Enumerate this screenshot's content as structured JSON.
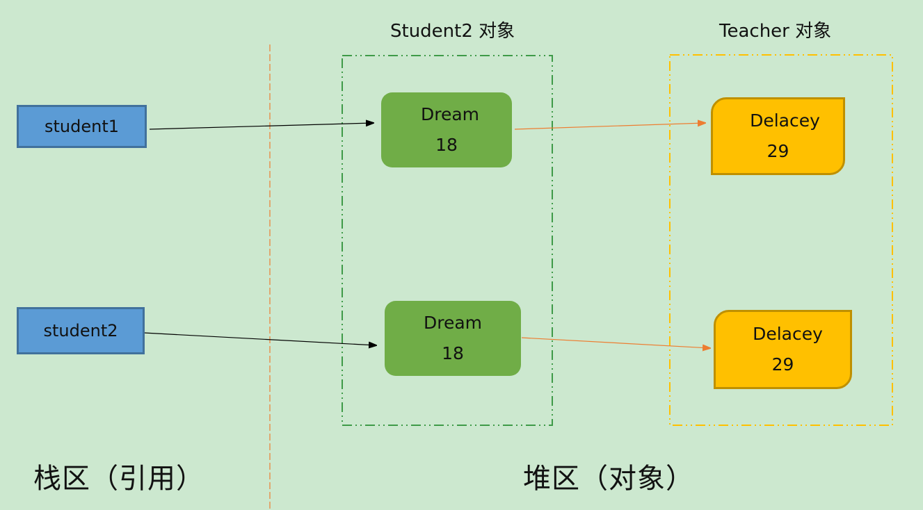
{
  "regions": {
    "stack_label": "栈区（引用）",
    "heap_label": "堆区（对象）"
  },
  "groups": {
    "student_group_title": "Student2 对象",
    "teacher_group_title": "Teacher 对象"
  },
  "references": [
    {
      "label": "student1"
    },
    {
      "label": "student2"
    }
  ],
  "student_objects": [
    {
      "name": "Dream",
      "age": "18"
    },
    {
      "name": "Dream",
      "age": "18"
    }
  ],
  "teacher_objects": [
    {
      "name": "Delacey",
      "age": "29"
    },
    {
      "name": "Delacey",
      "age": "29"
    }
  ],
  "colors": {
    "background": "#cce8cf",
    "reference_fill": "#5b9bd5",
    "reference_border": "#41719c",
    "student_fill": "#70ad47",
    "teacher_fill": "#ffc000",
    "teacher_border": "#bf9000",
    "divider": "#ed7d31",
    "student_group_border": "#3e9a48",
    "teacher_group_border": "#ffc000",
    "ref_arrow": "#000000",
    "teacher_arrow": "#ed7d31"
  }
}
